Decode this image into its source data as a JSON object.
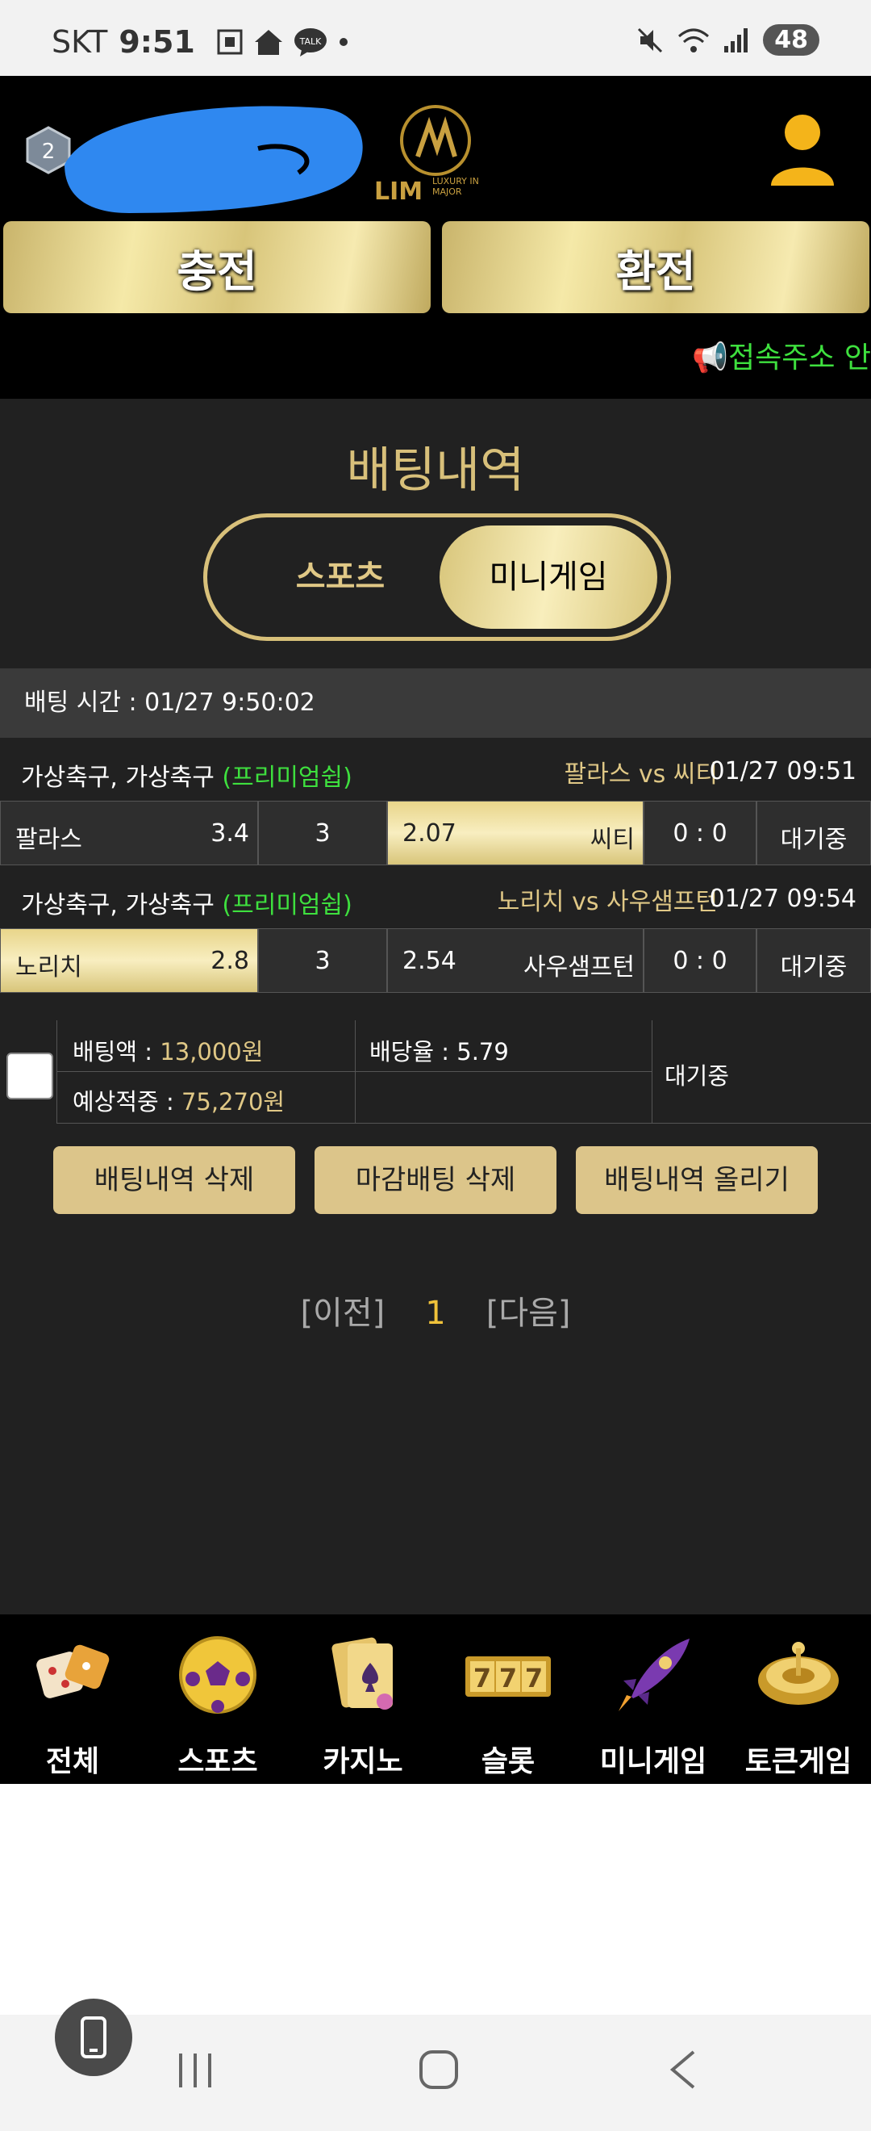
{
  "status_bar": {
    "carrier": "SKT",
    "time": "9:51",
    "battery": "48"
  },
  "header": {
    "logo_text": "LIM",
    "logo_sub": "LUXURY IN MAJOR",
    "charge_button": "충전",
    "exchange_button": "환전",
    "notice": "접속주소 안"
  },
  "page": {
    "title": "배팅내역",
    "tabs": {
      "sports": "스포츠",
      "minigame": "미니게임"
    },
    "bet_time": "배팅 시간 : 01/27 9:50:02"
  },
  "matches": [
    {
      "league": "가상축구, 가상축구",
      "premium": "(프리미엄쉽)",
      "teams": "팔라스  vs  씨티",
      "time": "01/27 09:51",
      "home": "팔라스",
      "home_odds": "3.4",
      "draw": "3",
      "away": "씨티",
      "away_odds": "2.07",
      "score": "0 : 0",
      "status": "대기중",
      "selected": "away"
    },
    {
      "league": "가상축구, 가상축구",
      "premium": "(프리미엄쉽)",
      "teams": "노리치  vs  사우샘프턴",
      "time": "01/27 09:54",
      "home": "노리치",
      "home_odds": "2.8",
      "draw": "3",
      "away": "사우샘프턴",
      "away_odds": "2.54",
      "score": "0 : 0",
      "status": "대기중",
      "selected": "home"
    }
  ],
  "summary": {
    "bet_amount_label": "배팅액 : ",
    "bet_amount": "13,000원",
    "odds_label": "배당율 : ",
    "odds": "5.79",
    "expected_label": "예상적중 : ",
    "expected": "75,270원",
    "status": "대기중"
  },
  "actions": {
    "delete_history": "배팅내역 삭제",
    "delete_closed": "마감배팅 삭제",
    "upload_history": "배팅내역 올리기"
  },
  "pager": {
    "prev": "[이전]",
    "current": "1",
    "next": "[다음]"
  },
  "bottom_nav": [
    {
      "label": "전체",
      "icon": "dice-icon"
    },
    {
      "label": "스포츠",
      "icon": "soccer-ball-icon"
    },
    {
      "label": "카지노",
      "icon": "playing-cards-icon"
    },
    {
      "label": "슬롯",
      "icon": "slot-777-icon"
    },
    {
      "label": "미니게임",
      "icon": "rocket-icon"
    },
    {
      "label": "토큰게임",
      "icon": "roulette-icon"
    }
  ],
  "colors": {
    "gold": "#d8c07a",
    "green": "#3ee03e",
    "panel": "#212121",
    "accent_number": "#f0c23a"
  }
}
